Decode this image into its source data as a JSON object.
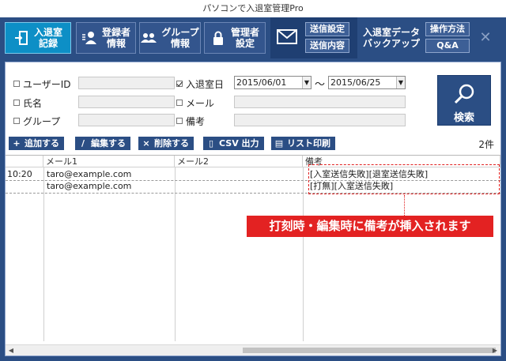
{
  "window": {
    "title": "パソコンで入退室管理Pro"
  },
  "menu": {
    "room_record": "入退室\n記録",
    "register_info": "登録者\n情報",
    "group_info": "グループ\n情報",
    "admin_settings": "管理者\n設定",
    "send_settings": "送信設定",
    "send_content": "送信内容",
    "backup": "入退室データ\nバックアップ",
    "manual": "操作方法",
    "qa": "Q&A",
    "close_glyph": "✕"
  },
  "search": {
    "user_id_label": "ユーザーID",
    "name_label": "氏名",
    "group_label": "グループ",
    "date_label": "入退室日",
    "date_from": "2015/06/01",
    "date_to": "2015/06/25",
    "tilde": "〜",
    "mail_label": "メール",
    "note_label": "備考",
    "search_button": "検索"
  },
  "toolbar": {
    "add": "追加する",
    "edit": "編集する",
    "delete": "削除する",
    "csv": "CSV 出力",
    "print": "リスト印刷",
    "count": "2件"
  },
  "table": {
    "headers": [
      "",
      "メール1",
      "メール2",
      "備考"
    ],
    "rows": [
      {
        "time": "10:20",
        "mail1": "taro@example.com",
        "mail2": "",
        "note": "[入室送信失敗][退室送信失敗]"
      },
      {
        "time": "",
        "mail1": "taro@example.com",
        "mail2": "",
        "note": "[打無][入室送信失敗]"
      }
    ]
  },
  "annotation": {
    "text": "打刻時・編集時に備考が挿入されます"
  },
  "colors": {
    "menu_bg": "#2b4e84",
    "accent": "#0d8fc6",
    "annotation": "#e32222"
  }
}
